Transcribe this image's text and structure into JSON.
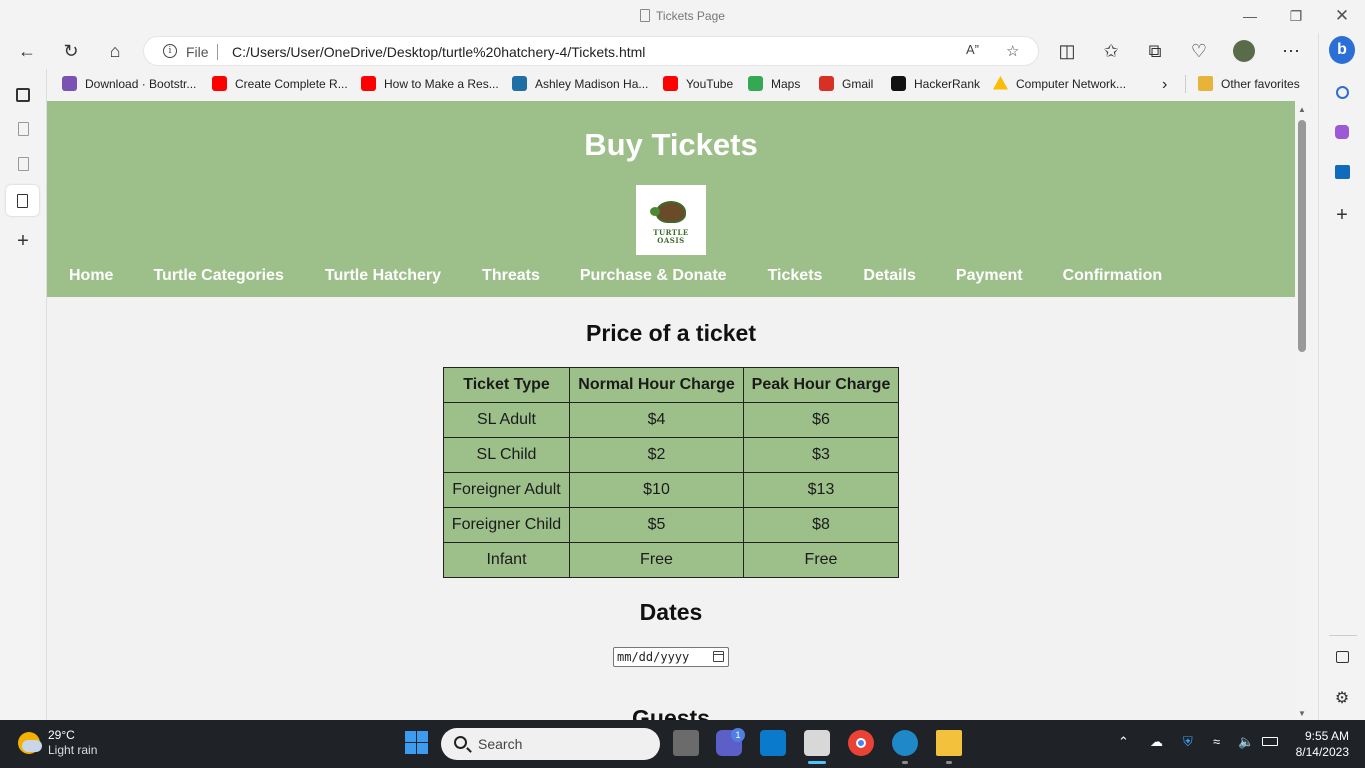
{
  "window": {
    "title": "Tickets Page"
  },
  "toolbar": {
    "file_label": "File",
    "url": "C:/Users/User/OneDrive/Desktop/turtle%20hatchery-4/Tickets.html"
  },
  "favorites": [
    {
      "label": "Download · Bootstr...",
      "color": "#7952b3"
    },
    {
      "label": "Create Complete R...",
      "color": "#ff0000"
    },
    {
      "label": "How to Make a Res...",
      "color": "#ff0000"
    },
    {
      "label": "Ashley Madison Ha...",
      "color": "#1d6fa5"
    },
    {
      "label": "YouTube",
      "color": "#ff0000"
    },
    {
      "label": "Maps",
      "color": "#34a853"
    },
    {
      "label": "Gmail",
      "color": "#d93025"
    },
    {
      "label": "HackerRank",
      "color": "#111111"
    },
    {
      "label": "Computer Network...",
      "color": "#fbbc04"
    }
  ],
  "other_favorites": "Other favorites",
  "page": {
    "heading": "Buy Tickets",
    "logo_text": "TURTLE OASIS",
    "nav": [
      "Home",
      "Turtle Categories",
      "Turtle Hatchery",
      "Threats",
      "Purchase & Donate",
      "Tickets",
      "Details",
      "Payment",
      "Confirmation"
    ],
    "price_heading": "Price of a ticket",
    "table": {
      "headers": [
        "Ticket Type",
        "Normal Hour Charge",
        "Peak Hour Charge"
      ],
      "rows": [
        [
          "SL Adult",
          "$4",
          "$6"
        ],
        [
          "SL Child",
          "$2",
          "$3"
        ],
        [
          "Foreigner Adult",
          "$10",
          "$13"
        ],
        [
          "Foreigner Child",
          "$5",
          "$8"
        ],
        [
          "Infant",
          "Free",
          "Free"
        ]
      ]
    },
    "dates_heading": "Dates",
    "date_placeholder": "mm/dd/yyyy",
    "guests_heading": "Guests"
  },
  "taskbar": {
    "temperature": "29°C",
    "weather": "Light rain",
    "search_label": "Search",
    "teams_badge": "1",
    "time": "9:55 AM",
    "date": "8/14/2023"
  },
  "colors": {
    "theme_green": "#9dc08b"
  }
}
